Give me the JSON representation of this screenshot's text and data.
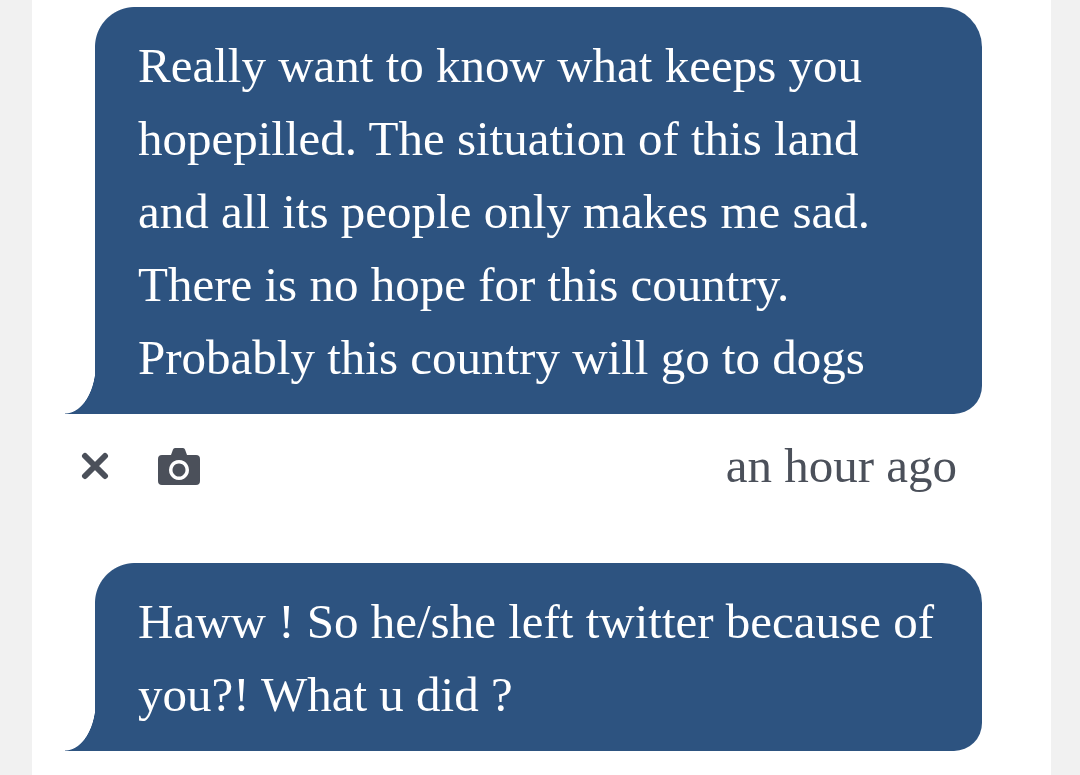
{
  "messages": [
    {
      "text": "Really want to know what keeps you hopepilled. The situation of this land and all its people only makes me sad. There is no hope for this country. Probably this country will go to dogs",
      "actions": [
        {
          "kind": "close"
        },
        {
          "kind": "camera"
        }
      ],
      "timestamp": "an hour ago"
    },
    {
      "text": "Haww ! So he/she left twitter because of you?! What u did ?"
    }
  ]
}
